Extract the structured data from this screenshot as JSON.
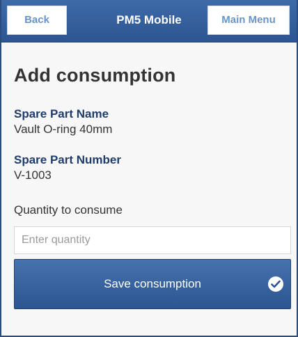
{
  "header": {
    "back_label": "Back",
    "title": "PM5 Mobile",
    "menu_label": "Main Menu"
  },
  "page": {
    "title": "Add consumption"
  },
  "spare_part": {
    "name_label": "Spare Part Name",
    "name_value": "Vault O-ring 40mm",
    "number_label": "Spare Part Number",
    "number_value": "V-1003"
  },
  "quantity": {
    "label": "Quantity to consume",
    "placeholder": "Enter quantity",
    "value": ""
  },
  "save_button": {
    "label": "Save consumption",
    "icon": "check-circle-icon"
  },
  "colors": {
    "header_blue": "#2c5591",
    "label_navy": "#1f3c6b",
    "button_text_light": "#6a94c7"
  }
}
